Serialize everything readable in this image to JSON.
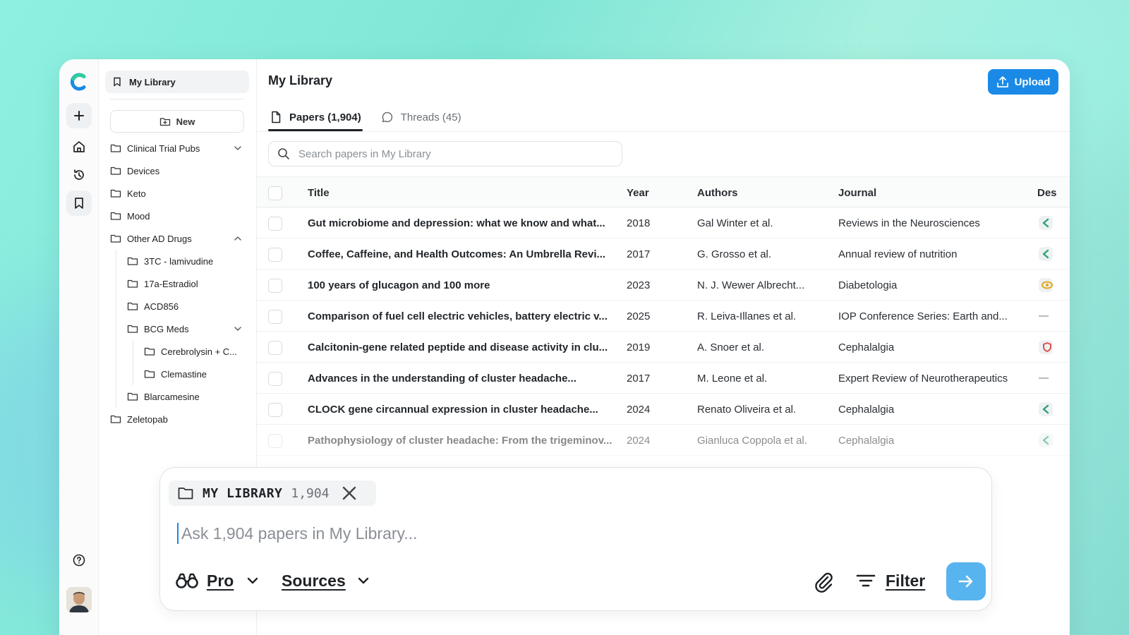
{
  "sidebar": {
    "library_label": "My Library",
    "new_label": "New",
    "folders": [
      {
        "label": "Clinical Trial Pubs"
      },
      {
        "label": "Devices"
      },
      {
        "label": "Keto"
      },
      {
        "label": "Mood"
      },
      {
        "label": "Other AD Drugs"
      },
      {
        "label": "3TC - lamivudine"
      },
      {
        "label": "17a-Estradiol"
      },
      {
        "label": "ACD856"
      },
      {
        "label": "BCG Meds"
      },
      {
        "label": "Cerebrolysin + C..."
      },
      {
        "label": "Clemastine"
      },
      {
        "label": "Blarcamesine"
      },
      {
        "label": "Zeletopab"
      }
    ]
  },
  "main": {
    "title": "My Library",
    "upload_label": "Upload",
    "tabs": [
      {
        "label": "Papers (1,904)",
        "active": true
      },
      {
        "label": "Threads (45)",
        "active": false
      }
    ],
    "search_placeholder": "Search papers in My Library"
  },
  "table": {
    "columns": [
      "Title",
      "Year",
      "Authors",
      "Journal",
      "Des"
    ],
    "rows": [
      {
        "title": "Gut microbiome and depression: what we know and what...",
        "year": "2018",
        "authors": "Gal Winter et al.",
        "journal": "Reviews in the Neurosciences",
        "desc": "icon-green"
      },
      {
        "title": "Coffee, Caffeine, and Health Outcomes: An Umbrella Revi...",
        "year": "2017",
        "authors": "G. Grosso et al.",
        "journal": "Annual review of nutrition",
        "desc": "icon-green"
      },
      {
        "title": "100 years of glucagon and 100 more",
        "year": "2023",
        "authors": "N. J. Wewer Albrecht...",
        "journal": "Diabetologia",
        "desc": "icon-yellow"
      },
      {
        "title": "Comparison of fuel cell electric vehicles, battery electric v...",
        "year": "2025",
        "authors": "R. Leiva-Illanes et al.",
        "journal": "IOP Conference Series: Earth and...",
        "desc": "dash"
      },
      {
        "title": "Calcitonin-gene related peptide and disease activity in clu...",
        "year": "2019",
        "authors": "A. Snoer et al.",
        "journal": "Cephalalgia",
        "desc": "icon-red"
      },
      {
        "title": "Advances in the understanding of cluster headache...",
        "year": "2017",
        "authors": "M. Leone et al.",
        "journal": "Expert Review of Neurotherapeutics",
        "desc": "dash"
      },
      {
        "title": "CLOCK gene circannual expression in cluster headache...",
        "year": "2024",
        "authors": "Renato Oliveira et al.",
        "journal": "Cephalalgia",
        "desc": "icon-green"
      },
      {
        "title": "Pathophysiology of cluster headache: From the trigeminov...",
        "year": "2024",
        "authors": "Gianluca Coppola et al.",
        "journal": "Cephalalgia",
        "desc": "icon-green"
      }
    ]
  },
  "chat": {
    "scope_name": "MY LIBRARY",
    "scope_count": "1,904",
    "placeholder": "Ask 1,904 papers in My Library...",
    "mode_label": "Pro",
    "sources_label": "Sources",
    "filter_label": "Filter"
  },
  "colors": {
    "accent": "#1a8ae6",
    "send": "#58b4ee",
    "logo_green": "#2ccf9a",
    "logo_blue": "#1a8ae6"
  }
}
